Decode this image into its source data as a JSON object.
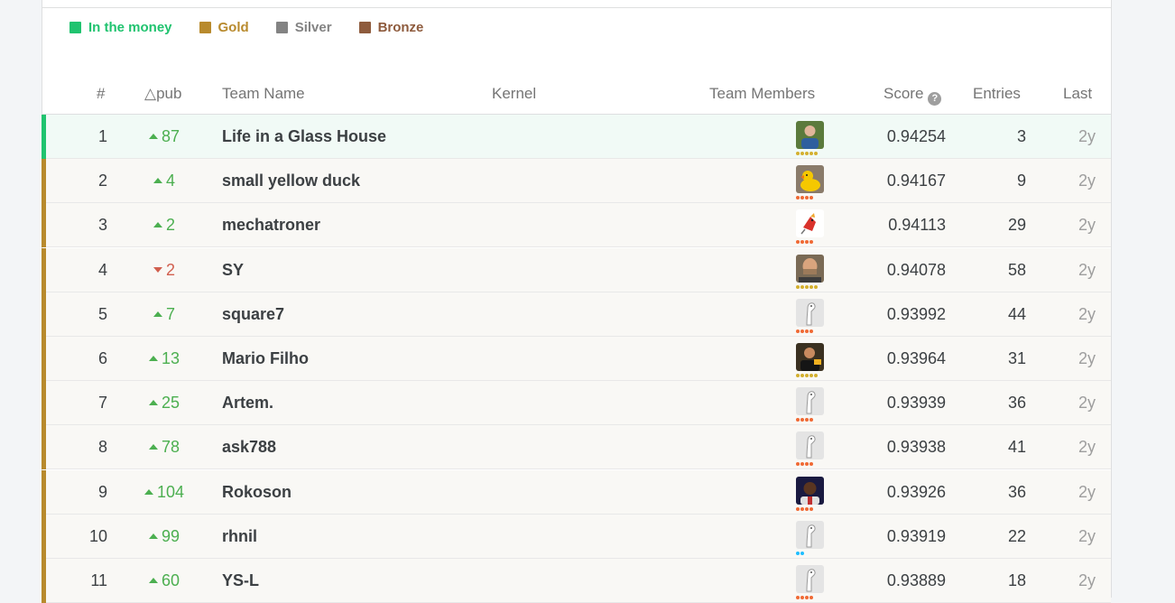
{
  "legend": [
    {
      "label": "In the money",
      "color": "#20c36f"
    },
    {
      "label": "Gold",
      "color": "#b88a2d"
    },
    {
      "label": "Silver",
      "color": "#838383"
    },
    {
      "label": "Bronze",
      "color": "#8e5b3d"
    }
  ],
  "columns": {
    "rank": "#",
    "delta": "△pub",
    "team": "Team Name",
    "kernel": "Kernel",
    "members": "Team Members",
    "score": "Score",
    "entries": "Entries",
    "last": "Last"
  },
  "rows": [
    {
      "rank": "1",
      "direction": "up",
      "delta": "87",
      "team": "Life in a Glass House",
      "avatar": "person-blue-shirt-avatar",
      "tier": "gold",
      "dots": 5,
      "score": "0.94254",
      "entries": "3",
      "last": "2y",
      "medal": "money"
    },
    {
      "rank": "2",
      "direction": "up",
      "delta": "4",
      "team": "small yellow duck",
      "avatar": "rubber-duck-avatar",
      "tier": "orange",
      "dots": 4,
      "score": "0.94167",
      "entries": "9",
      "last": "2y",
      "medal": "gold"
    },
    {
      "rank": "3",
      "direction": "up",
      "delta": "2",
      "team": "mechatroner",
      "avatar": "red-bird-avatar",
      "tier": "orange",
      "dots": 4,
      "score": "0.94113",
      "entries": "29",
      "last": "2y",
      "medal": "gold"
    },
    {
      "rank": "4",
      "direction": "down",
      "delta": "2",
      "team": "SY",
      "avatar": "bald-man-avatar",
      "tier": "gold",
      "dots": 5,
      "score": "0.94078",
      "entries": "58",
      "last": "2y",
      "medal": "gold"
    },
    {
      "rank": "5",
      "direction": "up",
      "delta": "7",
      "team": "square7",
      "avatar": "default-goose-avatar",
      "tier": "orange",
      "dots": 4,
      "score": "0.93992",
      "entries": "44",
      "last": "2y",
      "medal": "gold"
    },
    {
      "rank": "6",
      "direction": "up",
      "delta": "13",
      "team": "Mario Filho",
      "avatar": "man-dark-shirt-avatar",
      "tier": "gold",
      "dots": 5,
      "score": "0.93964",
      "entries": "31",
      "last": "2y",
      "medal": "gold"
    },
    {
      "rank": "7",
      "direction": "up",
      "delta": "25",
      "team": "Artem.",
      "avatar": "default-goose-avatar",
      "tier": "orange",
      "dots": 4,
      "score": "0.93939",
      "entries": "36",
      "last": "2y",
      "medal": "gold"
    },
    {
      "rank": "8",
      "direction": "up",
      "delta": "78",
      "team": "ask788",
      "avatar": "default-goose-avatar",
      "tier": "orange",
      "dots": 4,
      "score": "0.93938",
      "entries": "41",
      "last": "2y",
      "medal": "gold"
    },
    {
      "rank": "9",
      "direction": "up",
      "delta": "104",
      "team": "Rokoson",
      "avatar": "man-portrait-avatar",
      "tier": "orange",
      "dots": 4,
      "score": "0.93926",
      "entries": "36",
      "last": "2y",
      "medal": "gold"
    },
    {
      "rank": "10",
      "direction": "up",
      "delta": "99",
      "team": "rhnil",
      "avatar": "default-goose-avatar",
      "tier": "blue",
      "dots": 2,
      "score": "0.93919",
      "entries": "22",
      "last": "2y",
      "medal": "gold"
    },
    {
      "rank": "11",
      "direction": "up",
      "delta": "60",
      "team": "YS-L",
      "avatar": "default-goose-avatar",
      "tier": "orange",
      "dots": 4,
      "score": "0.93889",
      "entries": "18",
      "last": "2y",
      "medal": "gold"
    }
  ],
  "colors": {
    "money": "#20c36f",
    "gold": "#b88a2d",
    "tier_gold": "#d4b02f",
    "tier_orange": "#f06a35",
    "tier_blue": "#20beff"
  }
}
